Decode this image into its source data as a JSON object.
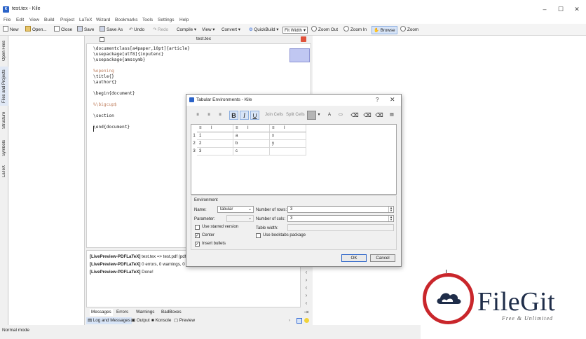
{
  "window": {
    "title": "test.tex - Kile",
    "icon": "kile-app-icon"
  },
  "menu": [
    "File",
    "Edit",
    "View",
    "Build",
    "Project",
    "LaTeX",
    "Wizard",
    "Bookmarks",
    "Tools",
    "Settings",
    "Help"
  ],
  "toolbar": {
    "new": "New",
    "open": "Open...",
    "close": "Close",
    "save": "Save",
    "save_as": "Save As",
    "undo": "Undo",
    "redo": "Redo",
    "compile": "Compile",
    "view": "View",
    "convert": "Convert",
    "quickbuild": "QuickBuild",
    "zoom_mode": "Fit Width",
    "zoom_out": "Zoom Out",
    "zoom_in": "Zoom In",
    "browse": "Browse",
    "zoom": "Zoom"
  },
  "sidebar_tabs": [
    "Open Files",
    "Files and Projects",
    "Structure",
    "Symbols",
    "LaTeX"
  ],
  "editor": {
    "tab_name": "test.tex",
    "lines": [
      {
        "t": "\\documentclass[a4paper,10pt]{article}",
        "kind": "code"
      },
      {
        "t": "\\usepackage[utf8]{inputenc}",
        "kind": "code"
      },
      {
        "t": "\\usepackage{amssymb}",
        "kind": "code"
      },
      {
        "t": "",
        "kind": "blank"
      },
      {
        "t": "%opening",
        "kind": "comment"
      },
      {
        "t": "\\title{}",
        "kind": "code"
      },
      {
        "t": "\\author{}",
        "kind": "code"
      },
      {
        "t": "",
        "kind": "blank"
      },
      {
        "t": "\\begin{document}",
        "kind": "code"
      },
      {
        "t": "",
        "kind": "blank"
      },
      {
        "t": "%\\bigcup$",
        "kind": "comment"
      },
      {
        "t": "",
        "kind": "blank"
      },
      {
        "t": "\\section",
        "kind": "code"
      },
      {
        "t": "",
        "kind": "blank"
      },
      {
        "t": "\\end{document}",
        "kind": "code"
      }
    ]
  },
  "log": {
    "lines": [
      {
        "tag": "[LivePreview-PDFLaTeX]",
        "msg": " test.tex => test.pdf (pdf"
      },
      {
        "tag": "[LivePreview-PDFLaTeX]",
        "msg": " 0 errors, 0 warnings, 0 ba"
      },
      {
        "tag": "[LivePreview-PDFLaTeX]",
        "msg": " Done!"
      }
    ],
    "tabs": [
      "Messages",
      "Errors",
      "Warnings",
      "BadBoxes"
    ],
    "bottom_tabs": [
      "Log and Messages",
      "Output",
      "Konsole",
      "Preview"
    ]
  },
  "status": {
    "mode": "Normal mode"
  },
  "dialog": {
    "title": "Tabular Environments - Kile",
    "help": "?",
    "close": "✕",
    "tools": {
      "bold": "B",
      "italic": "I",
      "underline": "U",
      "join_cells": "Join Cells",
      "split_cells": "Split Cells"
    },
    "columns": [
      "l",
      "l",
      "l"
    ],
    "rows": [
      {
        "num": "1",
        "cells": [
          "1",
          "a",
          "x"
        ]
      },
      {
        "num": "2",
        "cells": [
          "2",
          "b",
          "y"
        ]
      },
      {
        "num": "3",
        "cells": [
          "3",
          "c",
          ""
        ]
      }
    ],
    "env_group": "Environment",
    "name_label": "Name:",
    "name_value": "tabular",
    "param_label": "Parameter:",
    "param_value": "",
    "rows_label": "Number of rows:",
    "rows_value": "3",
    "cols_label": "Number of cols:",
    "cols_value": "3",
    "table_width_label": "Table width:",
    "starred": {
      "label": "Use starred version",
      "checked": false
    },
    "center": {
      "label": "Center",
      "checked": true
    },
    "bullets": {
      "label": "Insert bullets",
      "checked": true
    },
    "booktabs": {
      "label": "Use booktabs package",
      "checked": false
    },
    "ok": "OK",
    "cancel": "Cancel"
  },
  "watermark": {
    "brand": "FileGit",
    "tagline": "Free & Unlimited",
    "accent": "#c9262b",
    "ink": "#1f2d49"
  }
}
